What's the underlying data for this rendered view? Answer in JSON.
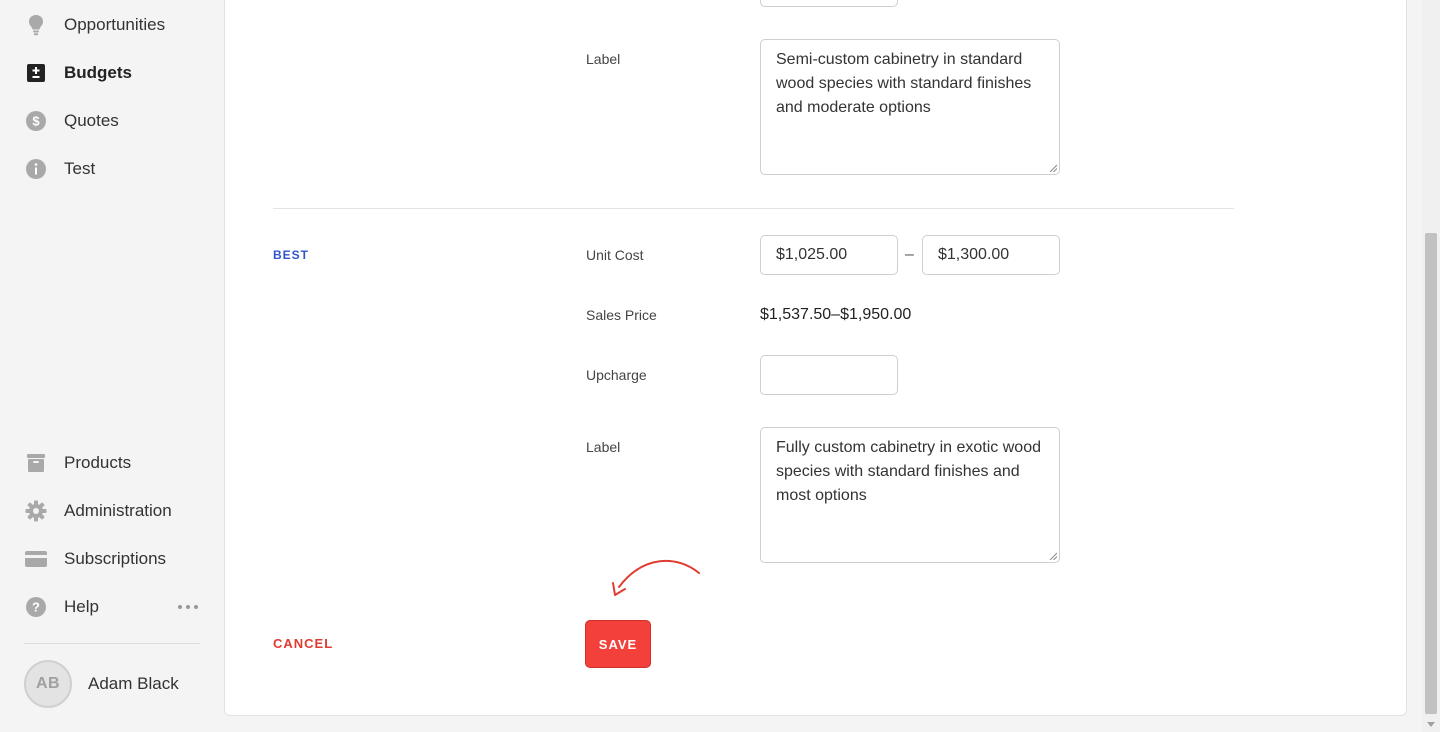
{
  "sidebar": {
    "top_items": [
      {
        "label": "Opportunities",
        "icon": "lightbulb-icon"
      },
      {
        "label": "Budgets",
        "icon": "plus-minus-icon",
        "active": true
      },
      {
        "label": "Quotes",
        "icon": "dollar-icon"
      },
      {
        "label": "Test",
        "icon": "info-icon"
      }
    ],
    "bottom_items": [
      {
        "label": "Products",
        "icon": "box-icon"
      },
      {
        "label": "Administration",
        "icon": "gear-icon"
      },
      {
        "label": "Subscriptions",
        "icon": "card-icon"
      },
      {
        "label": "Help",
        "icon": "help-icon"
      }
    ],
    "user": {
      "initials": "AB",
      "name": "Adam Black"
    }
  },
  "form": {
    "better": {
      "label_field_label": "Label",
      "label_value": "Semi-custom cabinetry in standard wood species with standard finishes and moderate options"
    },
    "best": {
      "tier": "BEST",
      "unit_cost_label": "Unit Cost",
      "unit_cost_min": "$1,025.00",
      "unit_cost_separator": "–",
      "unit_cost_max": "$1,300.00",
      "sales_price_label": "Sales Price",
      "sales_price_value": "$1,537.50–$1,950.00",
      "upcharge_label": "Upcharge",
      "upcharge_value": "",
      "label_field_label": "Label",
      "label_value": "Fully custom cabinetry in exotic wood species with standard finishes and most options"
    },
    "actions": {
      "cancel_label": "CANCEL",
      "save_label": "SAVE"
    }
  },
  "colors": {
    "accent_red": "#f4403a",
    "tier_blue": "#3355cc"
  }
}
